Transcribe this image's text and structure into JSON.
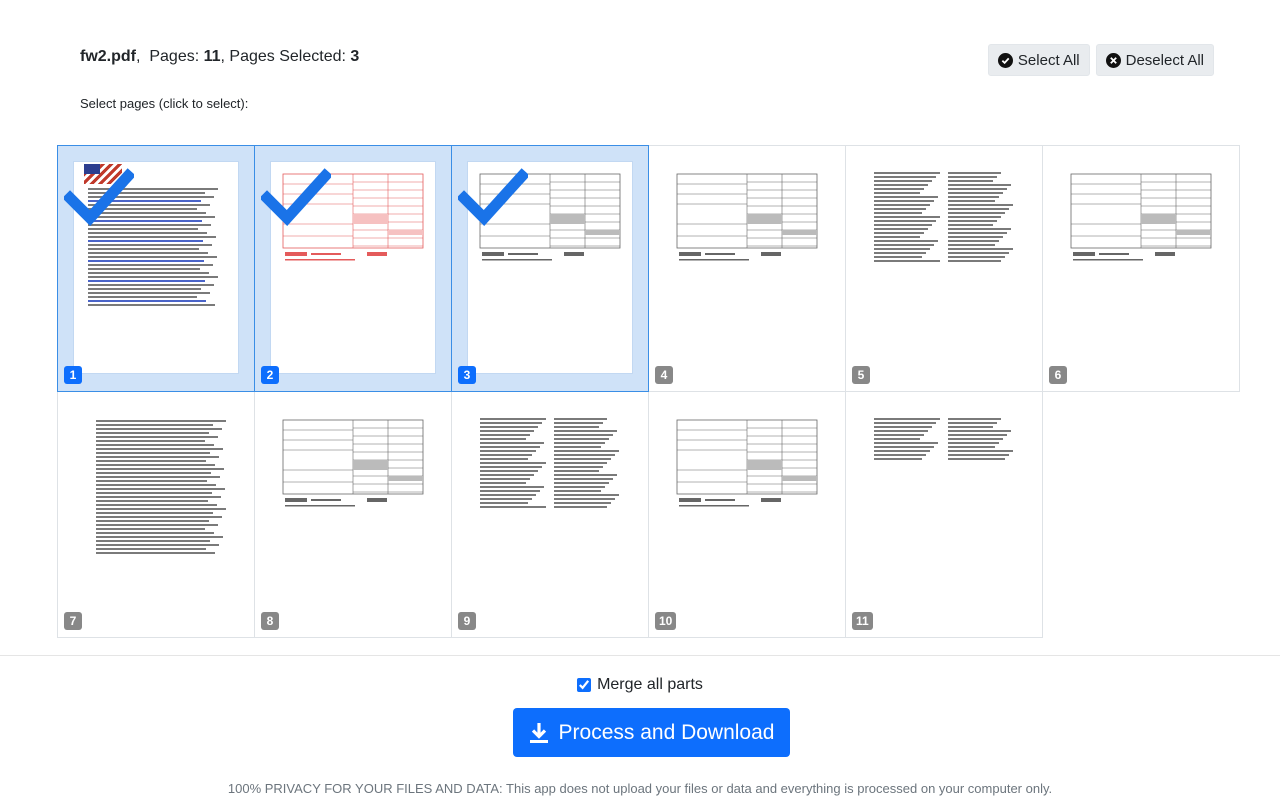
{
  "file": {
    "name": "fw2.pdf",
    "pages_label": "Pages:",
    "pages_count": "11",
    "selected_label": "Pages Selected:",
    "selected_count": "3"
  },
  "hint": "Select pages (click to select):",
  "actions": {
    "select_all": "Select All",
    "deselect_all": "Deselect All"
  },
  "pages": [
    {
      "number": "1",
      "selected": true,
      "kind": "cover"
    },
    {
      "number": "2",
      "selected": true,
      "kind": "form-red"
    },
    {
      "number": "3",
      "selected": true,
      "kind": "form"
    },
    {
      "number": "4",
      "selected": false,
      "kind": "form"
    },
    {
      "number": "5",
      "selected": false,
      "kind": "text2"
    },
    {
      "number": "6",
      "selected": false,
      "kind": "form"
    },
    {
      "number": "7",
      "selected": false,
      "kind": "text1"
    },
    {
      "number": "8",
      "selected": false,
      "kind": "form"
    },
    {
      "number": "9",
      "selected": false,
      "kind": "text2"
    },
    {
      "number": "10",
      "selected": false,
      "kind": "form"
    },
    {
      "number": "11",
      "selected": false,
      "kind": "text2short"
    }
  ],
  "merge": {
    "label": "Merge all parts",
    "checked": true
  },
  "process_button": "Process and Download",
  "privacy": "100% PRIVACY FOR YOUR FILES AND DATA: This app does not upload your files or data and everything is processed on your computer only.",
  "colors": {
    "accent": "#0d6efd",
    "selected_bg": "#cfe2f8",
    "form_red": "#e45b5b"
  }
}
